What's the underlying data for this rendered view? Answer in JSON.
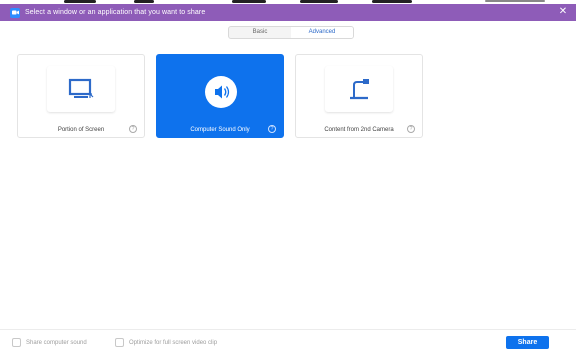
{
  "window": {
    "title": "Select a window or an application that you want to share",
    "close_glyph": "✕",
    "app_icon": "zoom-camera-icon"
  },
  "tabs": [
    {
      "label": "Basic",
      "active": false
    },
    {
      "label": "Advanced",
      "active": true
    }
  ],
  "options": [
    {
      "label": "Portion of Screen",
      "icon": "screen-portion-icon",
      "selected": false
    },
    {
      "label": "Computer Sound Only",
      "icon": "speaker-icon",
      "selected": true
    },
    {
      "label": "Content from 2nd Camera",
      "icon": "camera-arm-icon",
      "selected": false
    }
  ],
  "help_glyph": "?",
  "footer": {
    "share_sound_label": "Share computer sound",
    "optimize_label": "Optimize for full screen video clip",
    "share_button": "Share"
  },
  "colors": {
    "titlebar": "#8e5cb8",
    "accent": "#0e72ed"
  }
}
